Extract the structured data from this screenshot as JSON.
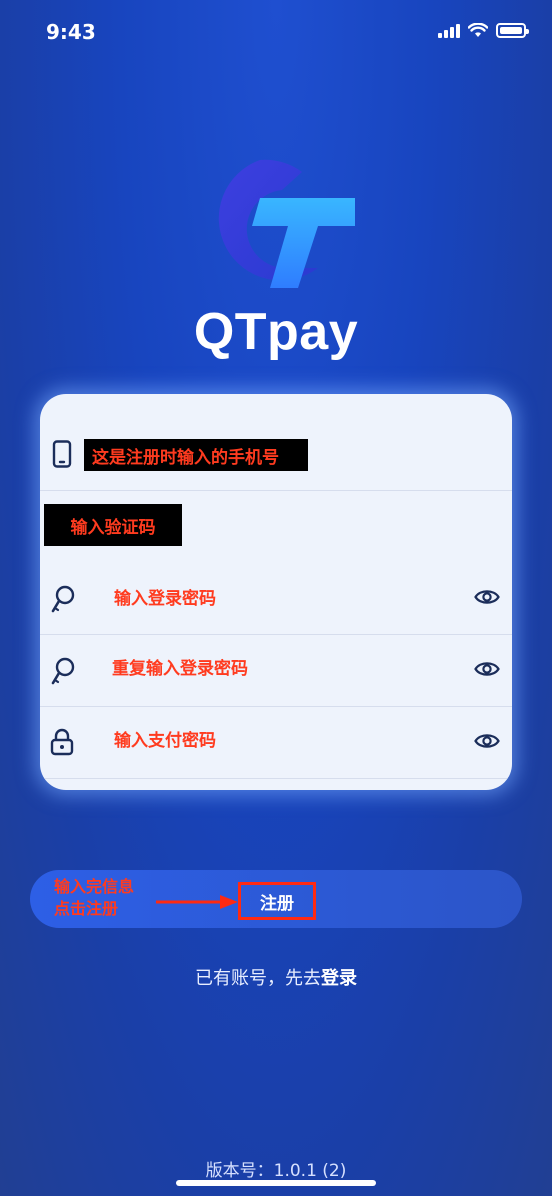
{
  "status_bar": {
    "time": "9:43"
  },
  "brand": {
    "name": "QTpay"
  },
  "form": {
    "phone_label": "这是注册时输入的手机号",
    "code_label": "输入验证码",
    "password_label": "输入登录密码",
    "repeat_password_label": "重复输入登录密码",
    "pay_password_label": "输入支付密码"
  },
  "register": {
    "hint_line1": "输入完信息",
    "hint_line2": "点击注册",
    "button_label": "注册"
  },
  "login_prompt": {
    "text": "已有账号，先去",
    "link": "登录"
  },
  "version": {
    "text": "版本号：1.0.1 (2)"
  },
  "colors": {
    "accent_red": "#ff3b1f",
    "background": "#1845bf",
    "card": "#eef3fc"
  },
  "icons": [
    "phone-icon",
    "key-icon",
    "lock-icon",
    "eye-icon"
  ]
}
